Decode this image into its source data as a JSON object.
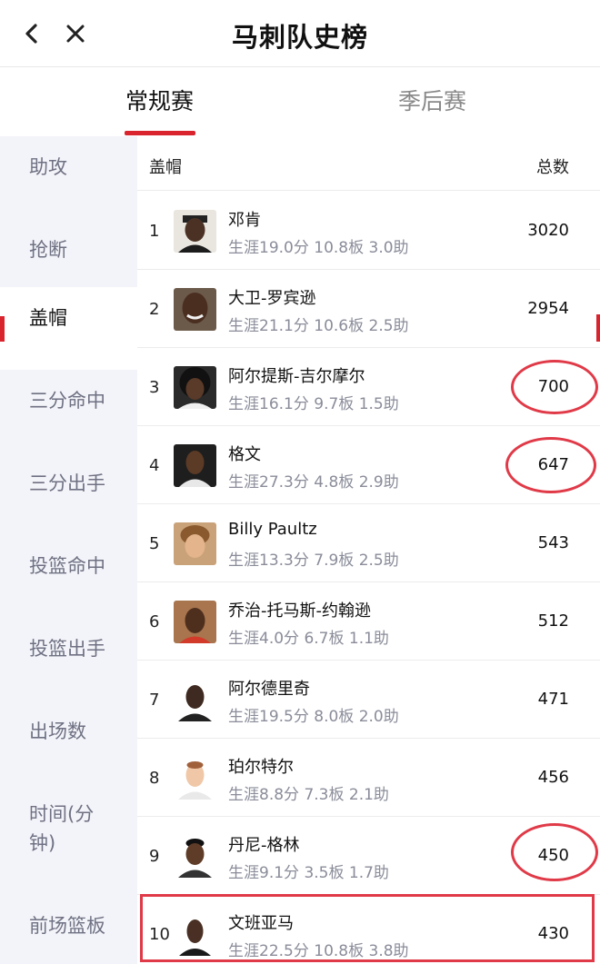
{
  "header": {
    "title": "马刺队史榜",
    "back_icon": "chevron-left-icon",
    "close_icon": "close-icon"
  },
  "tabs": [
    {
      "label": "常规赛",
      "active": true
    },
    {
      "label": "季后赛",
      "active": false
    }
  ],
  "sidebar": {
    "items": [
      {
        "label": "助攻",
        "active": false
      },
      {
        "label": "抢断",
        "active": false
      },
      {
        "label": "盖帽",
        "active": true
      },
      {
        "label": "三分命中",
        "active": false
      },
      {
        "label": "三分出手",
        "active": false
      },
      {
        "label": "投篮命中",
        "active": false
      },
      {
        "label": "投篮出手",
        "active": false
      },
      {
        "label": "出场数",
        "active": false
      },
      {
        "label": "时间(分钟)",
        "active": false
      },
      {
        "label": "前场篮板",
        "active": false
      }
    ]
  },
  "list": {
    "header_category": "盖帽",
    "header_total": "总数",
    "rows": [
      {
        "rank": "1",
        "name": "邓肯",
        "stats": "生涯19.0分  10.8板  3.0助",
        "total": "3020"
      },
      {
        "rank": "2",
        "name": "大卫-罗宾逊",
        "stats": "生涯21.1分  10.6板  2.5助",
        "total": "2954"
      },
      {
        "rank": "3",
        "name": "阿尔提斯-吉尔摩尔",
        "stats": "生涯16.1分  9.7板  1.5助",
        "total": "700"
      },
      {
        "rank": "4",
        "name": "格文",
        "stats": "生涯27.3分  4.8板  2.9助",
        "total": "647"
      },
      {
        "rank": "5",
        "name": "Billy Paultz",
        "stats": "生涯13.3分  7.9板  2.5助",
        "total": "543"
      },
      {
        "rank": "6",
        "name": "乔治-托马斯-约翰逊",
        "stats": "生涯4.0分  6.7板  1.1助",
        "total": "512"
      },
      {
        "rank": "7",
        "name": "阿尔德里奇",
        "stats": "生涯19.5分  8.0板  2.0助",
        "total": "471"
      },
      {
        "rank": "8",
        "name": "珀尔特尔",
        "stats": "生涯8.8分  7.3板  2.1助",
        "total": "456"
      },
      {
        "rank": "9",
        "name": "丹尼-格林",
        "stats": "生涯9.1分  3.5板  1.7助",
        "total": "450"
      },
      {
        "rank": "10",
        "name": "文班亚马",
        "stats": "生涯22.5分  10.8板  3.8助",
        "total": "430"
      }
    ]
  },
  "colors": {
    "accent": "#d9232d",
    "annotation": "#e03a48",
    "sidebar_bg": "#f3f4f9",
    "muted_text": "#8a8c99"
  }
}
